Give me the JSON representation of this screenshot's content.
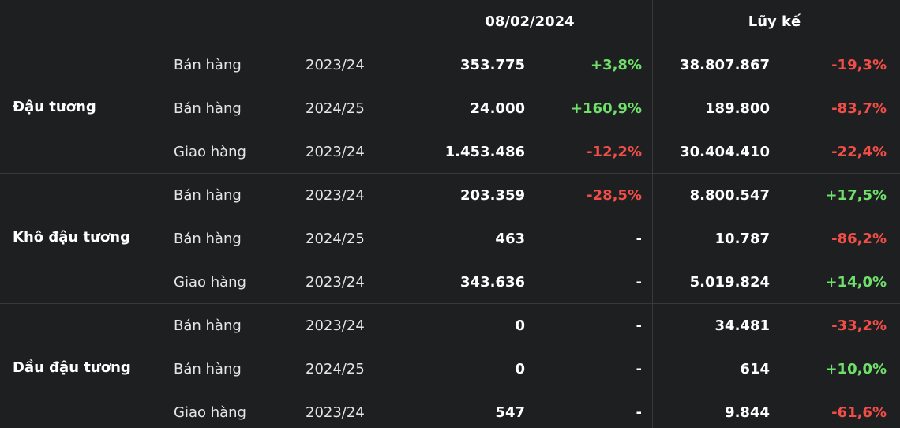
{
  "header": {
    "date": "08/02/2024",
    "cumulative": "Lũy kế"
  },
  "colors": {
    "background": "#1e1f21",
    "divider": "#38393c",
    "positive": "#6fe06a",
    "negative": "#f24e47",
    "text": "#ffffff"
  },
  "groups": [
    {
      "name": "Đậu tương",
      "rows": [
        {
          "type": "Bán hàng",
          "season": "2023/24",
          "value": "353.775",
          "change": "+3,8%",
          "change_sign": "pos",
          "cumulative": "38.807.867",
          "cumulative_change": "-19,3%",
          "cumulative_sign": "neg"
        },
        {
          "type": "Bán hàng",
          "season": "2024/25",
          "value": "24.000",
          "change": "+160,9%",
          "change_sign": "pos",
          "cumulative": "189.800",
          "cumulative_change": "-83,7%",
          "cumulative_sign": "neg"
        },
        {
          "type": "Giao hàng",
          "season": "2023/24",
          "value": "1.453.486",
          "change": "-12,2%",
          "change_sign": "neg",
          "cumulative": "30.404.410",
          "cumulative_change": "-22,4%",
          "cumulative_sign": "neg"
        }
      ]
    },
    {
      "name": "Khô đậu tương",
      "rows": [
        {
          "type": "Bán hàng",
          "season": "2023/24",
          "value": "203.359",
          "change": "-28,5%",
          "change_sign": "neg",
          "cumulative": "8.800.547",
          "cumulative_change": "+17,5%",
          "cumulative_sign": "pos"
        },
        {
          "type": "Bán hàng",
          "season": "2024/25",
          "value": "463",
          "change": "-",
          "change_sign": "neu",
          "cumulative": "10.787",
          "cumulative_change": "-86,2%",
          "cumulative_sign": "neg"
        },
        {
          "type": "Giao hàng",
          "season": "2023/24",
          "value": "343.636",
          "change": "-",
          "change_sign": "neu",
          "cumulative": "5.019.824",
          "cumulative_change": "+14,0%",
          "cumulative_sign": "pos"
        }
      ]
    },
    {
      "name": "Dầu đậu tương",
      "rows": [
        {
          "type": "Bán hàng",
          "season": "2023/24",
          "value": "0",
          "change": "-",
          "change_sign": "neu",
          "cumulative": "34.481",
          "cumulative_change": "-33,2%",
          "cumulative_sign": "neg"
        },
        {
          "type": "Bán hàng",
          "season": "2024/25",
          "value": "0",
          "change": "-",
          "change_sign": "neu",
          "cumulative": "614",
          "cumulative_change": "+10,0%",
          "cumulative_sign": "pos"
        },
        {
          "type": "Giao hàng",
          "season": "2023/24",
          "value": "547",
          "change": "-",
          "change_sign": "neu",
          "cumulative": "9.844",
          "cumulative_change": "-61,6%",
          "cumulative_sign": "neg"
        }
      ]
    }
  ]
}
